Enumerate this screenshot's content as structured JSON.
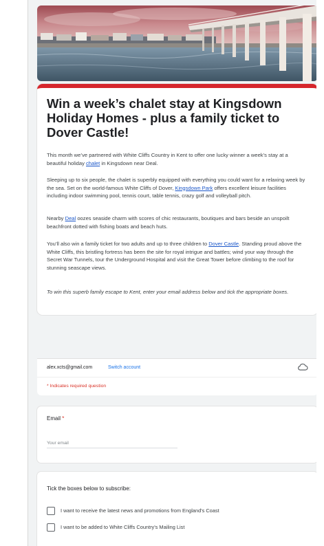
{
  "form": {
    "title": "Win a week’s chalet stay at Kingsdown Holiday Homes - plus a family ticket to Dover Castle!",
    "intro": {
      "p1_before": "This month we’ve partnered with White Cliffs Country in Kent to offer one lucky winner a week’s stay at a beautiful holiday ",
      "p1_link": "chalet",
      "p1_after": " in Kingsdown near Deal.",
      "p2_before": "Sleeping up to six people, the chalet is superbly equipped with everything you could want for a relaxing week by the sea. Set on the world-famous White Cliffs of Dover, ",
      "p2_link": "Kingsdown Park",
      "p2_after": " offers excellent leisure facilities including indoor swimming pool, tennis court, table tennis, crazy golf and volleyball pitch.",
      "p3_before": "Nearby ",
      "p3_link": "Deal",
      "p3_after": " oozes seaside charm with scores of chic restaurants, boutiques and bars beside an unspoilt beachfront dotted with fishing boats and beach huts.",
      "p4_before": "You’ll also win a family ticket for two adults and up to three children to ",
      "p4_link": "Dover Castle",
      "p4_after": ". Standing proud above the White Cliffs, this bristling fortress has been the site for royal intrigue and battles; wind your way through the Secret War Tunnels, tour the Underground Hospital and visit the Great Tower before climbing to the roof for stunning seascape views.",
      "p5": "To win this superb family escape to Kent, enter your email address below and tick the appropriate boxes."
    },
    "account": {
      "email": "alex.xcts@gmail.com",
      "switch_label": "Switch account",
      "cloud_icon": "cloud-sync-icon"
    },
    "required_note": "* Indicates required question",
    "email_question": {
      "label": "Email",
      "required_mark": "*",
      "placeholder": "Your email"
    },
    "subscribe": {
      "title": "Tick the boxes below to subscribe:",
      "options": [
        "I want to receive the latest news and promotions from England's Coast",
        "I want to be added to White Cliffs Country's Mailing List"
      ]
    },
    "accent_color": "#d6262c"
  }
}
